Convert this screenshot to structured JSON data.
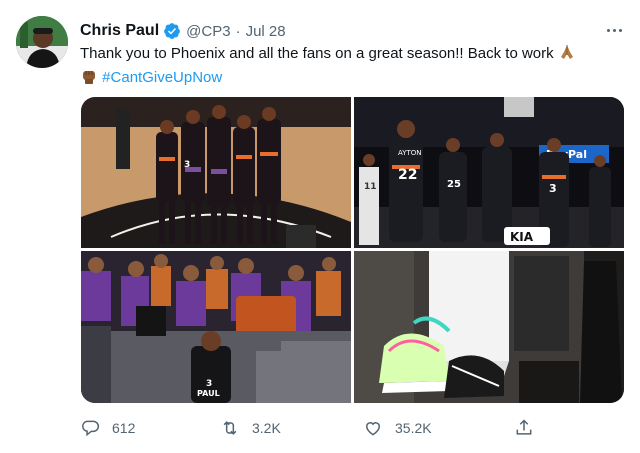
{
  "tweet": {
    "author": {
      "display_name": "Chris Paul",
      "handle": "@CP3",
      "verified": true,
      "avatar_icon": "profile-photo"
    },
    "separator": "·",
    "date": "Jul 28",
    "more_icon": "more-horizontal-icon",
    "text": {
      "line1": "Thank you to Phoenix and all the fans on a great season!! Back to work",
      "line2_hashtag": "#CantGiveUpNow"
    },
    "emojis": [
      "folded-hands",
      "raised-fist"
    ],
    "media": {
      "count": 4,
      "jersey_texts": [
        "22",
        "AYTON",
        "25",
        "3",
        "11",
        "PAUL",
        "3"
      ],
      "sponsor_text": "KIA",
      "banner_text": "PayPal"
    },
    "actions": {
      "reply": {
        "icon": "reply-icon",
        "count": "612"
      },
      "retweet": {
        "icon": "retweet-icon",
        "count": "3.2K"
      },
      "like": {
        "icon": "heart-icon",
        "count": "35.2K"
      },
      "share": {
        "icon": "share-icon",
        "count": ""
      }
    }
  },
  "colors": {
    "text": "#0f1419",
    "secondary": "#536471",
    "link": "#1d9bf0",
    "verified": "#1d9bf0"
  }
}
